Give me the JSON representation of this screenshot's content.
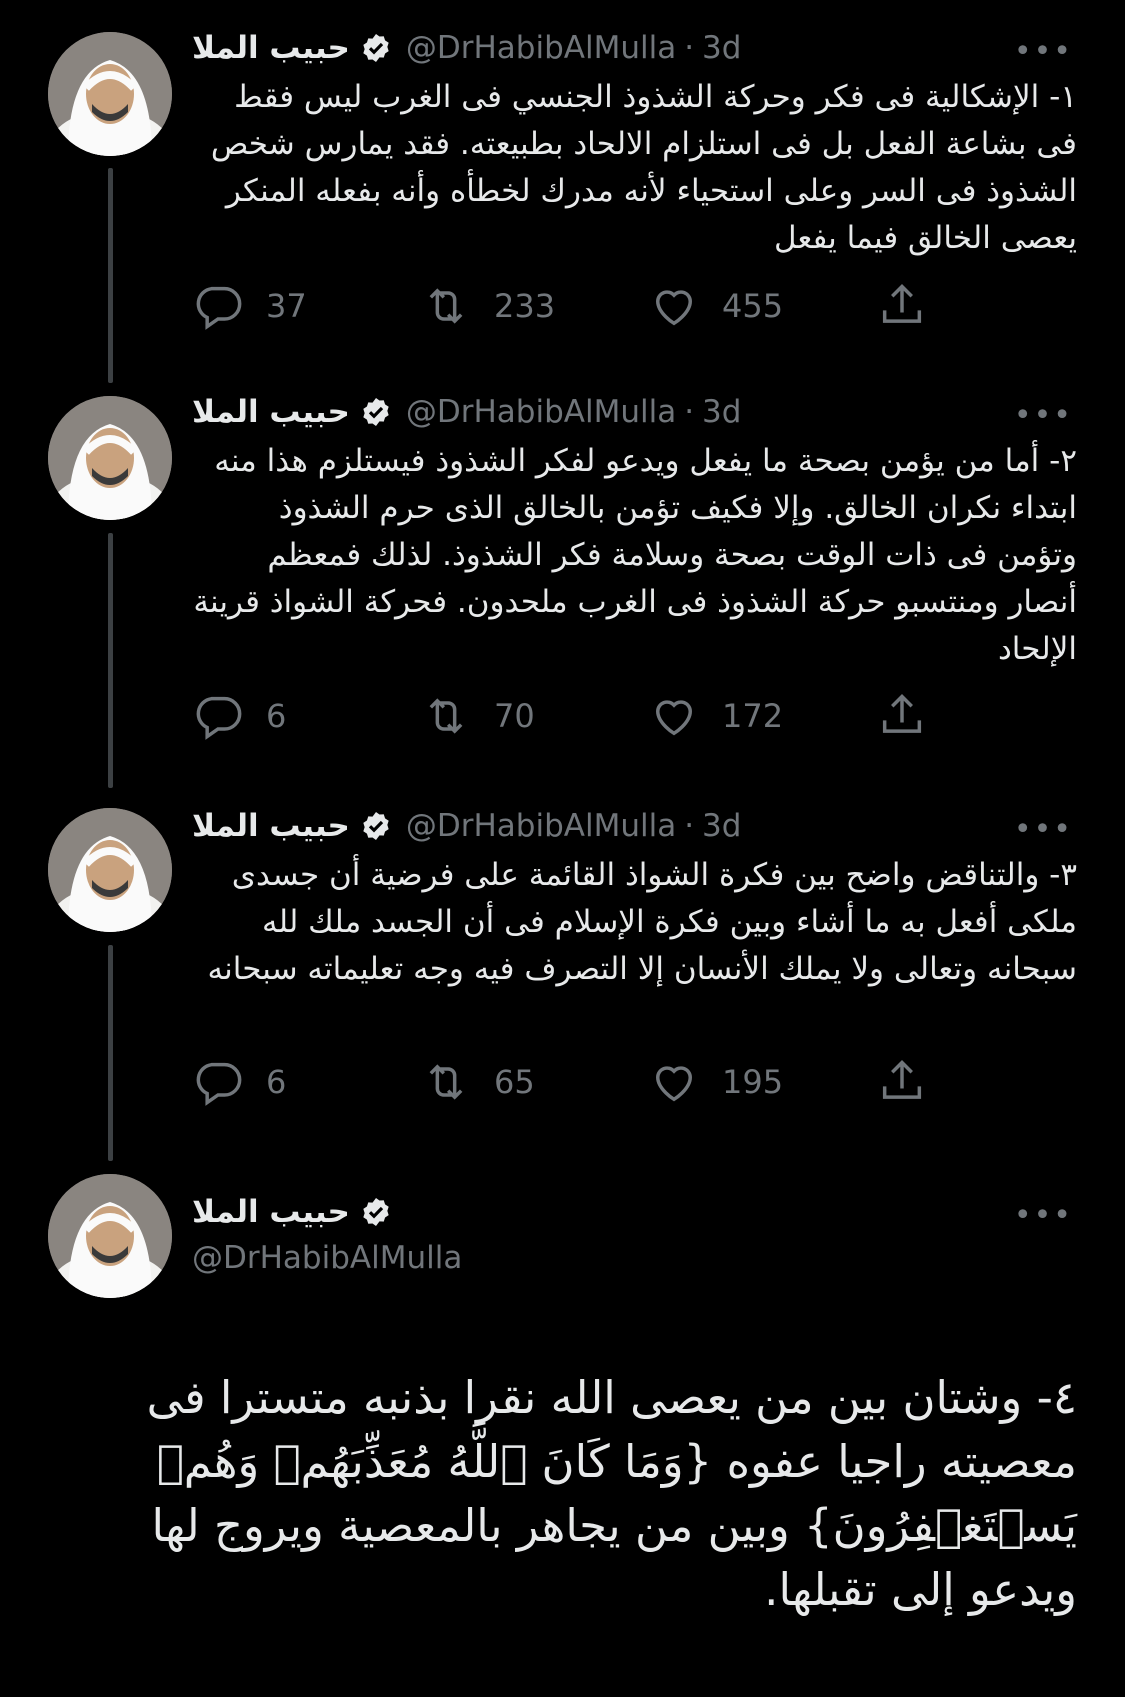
{
  "author": {
    "name": "حبيب الملا",
    "handle": "@DrHabibAlMulla"
  },
  "tweets": [
    {
      "time": "3d",
      "text": "١- الإشكالية فى فكر وحركة الشذوذ الجنسي فى الغرب ليس فقط فى بشاعة الفعل بل فى استلزام الالحاد بطبيعته. فقد يمارس شخص الشذوذ فى السر وعلى استحياء لأنه مدرك لخطأه وأنه بفعله المنكر يعصى الخالق فيما يفعل",
      "replies": "37",
      "retweets": "233",
      "likes": "455"
    },
    {
      "time": "3d",
      "text": "٢- أما من يؤمن بصحة ما يفعل ويدعو لفكر الشذوذ فيستلزم هذا منه ابتداء نكران الخالق. وإلا فكيف تؤمن بالخالق الذى حرم الشذوذ وتؤمن فى ذات الوقت بصحة وسلامة فكر الشذوذ. لذلك فمعظم أنصار ومنتسبو حركة الشذوذ فى الغرب ملحدون. فحركة الشواذ قرينة الإلحاد",
      "replies": "6",
      "retweets": "70",
      "likes": "172"
    },
    {
      "time": "3d",
      "text": "٣- والتناقض واضح بين فكرة الشواذ القائمة على فرضية أن جسدى ملكى أفعل به ما أشاء وبين فكرة الإسلام فى أن الجسد ملك لله سبحانه وتعالى ولا يملك الأنسان إلا التصرف فيه وجه تعليماته سبحانه",
      "replies": "6",
      "retweets": "65",
      "likes": "195"
    }
  ],
  "main_tweet": {
    "text": "٤- وشتان بين من يعصى الله نقرا  بذنبه متسترا فى معصيته راجيا عفوه  {وَمَا كَانَ ٱللَّهُ مُعَذِّبَهُمۡ وَهُمۡ يَسۡتَغۡفِرُونَ} وبين من يجاهر بالمعصية ويروج لها ويدعو إلى تقبلها."
  },
  "more_label": "•••",
  "dot_separator": "·",
  "colors": {
    "background": "#000000",
    "text": "#e7e9ea",
    "secondary": "#71767b",
    "thread_line": "#3c4043"
  },
  "icons": [
    "reply-icon",
    "retweet-icon",
    "like-icon",
    "share-icon",
    "verified-icon",
    "more-icon"
  ]
}
